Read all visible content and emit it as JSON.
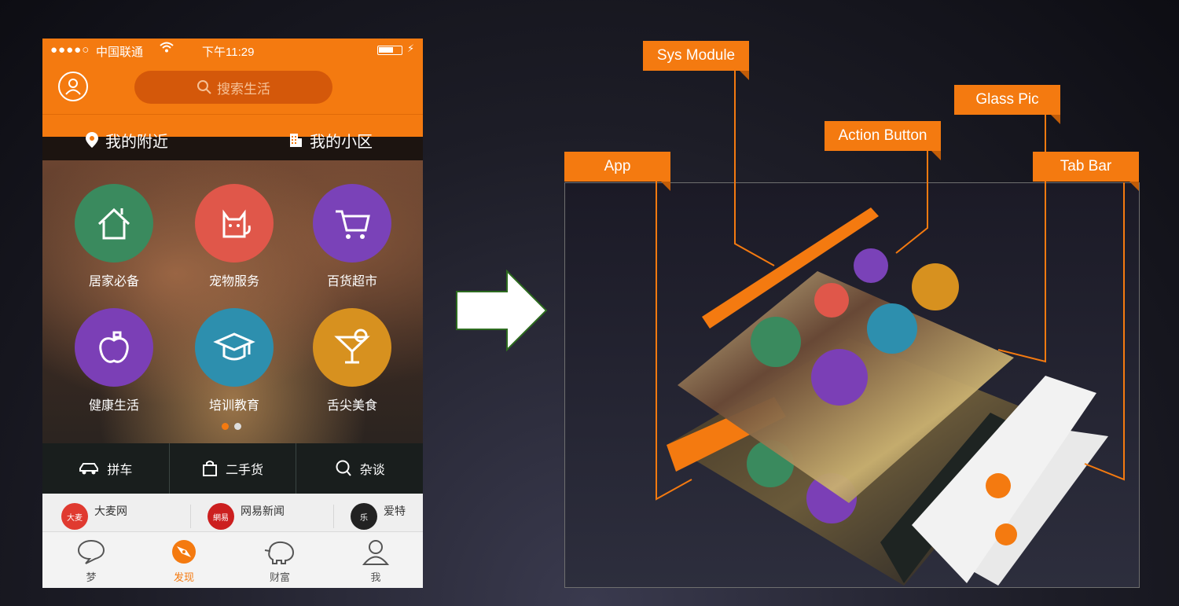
{
  "status_bar": {
    "signal": "●●●●○",
    "carrier": "中国联通",
    "time": "下午11:29"
  },
  "header": {
    "search_placeholder": "搜索生活",
    "tab_nearby": "我的附近",
    "tab_community": "我的小区"
  },
  "categories": [
    {
      "label": "居家必备",
      "icon": "house-icon",
      "color": "#3a8a5e"
    },
    {
      "label": "宠物服务",
      "icon": "cat-icon",
      "color": "#e0574a"
    },
    {
      "label": "百货超市",
      "icon": "cart-icon",
      "color": "#7a42b8"
    },
    {
      "label": "健康生活",
      "icon": "apple-icon",
      "color": "#7b3fb6"
    },
    {
      "label": "培训教育",
      "icon": "graduation-cap-icon",
      "color": "#2d8fae"
    },
    {
      "label": "舌尖美食",
      "icon": "cocktail-icon",
      "color": "#d7911f"
    }
  ],
  "quick_actions": [
    {
      "label": "拼车",
      "icon": "car-icon"
    },
    {
      "label": "二手货",
      "icon": "bag-icon"
    },
    {
      "label": "杂谈",
      "icon": "chat-icon"
    }
  ],
  "feed": [
    {
      "name": "大麦网",
      "logo_text": "大麦",
      "color": "#e03a30"
    },
    {
      "name": "网易新闻",
      "logo_text": "網易",
      "color": "#cc1f1f"
    },
    {
      "name": "爱特",
      "logo_text": "乐",
      "color": "#222222"
    }
  ],
  "tab_bar": [
    {
      "label": "梦",
      "icon": "speech-bubble-icon",
      "active": false
    },
    {
      "label": "发现",
      "icon": "discover-icon",
      "active": true
    },
    {
      "label": "财富",
      "icon": "piggy-bank-icon",
      "active": false
    },
    {
      "label": "我",
      "icon": "person-icon",
      "active": false
    }
  ],
  "callouts": {
    "sys_module": "Sys Module",
    "glass_pic": "Glass Pic",
    "action_button": "Action Button",
    "app": "App",
    "tab_bar": "Tab Bar"
  },
  "accent_color": "#f47a10"
}
